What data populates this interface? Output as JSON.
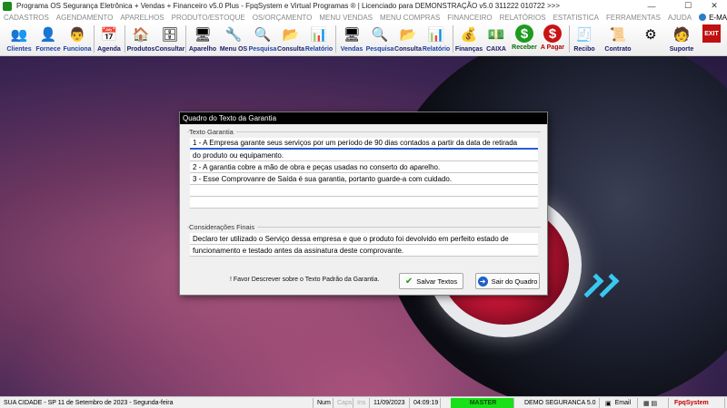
{
  "window": {
    "title": "Programa OS Segurança Eletrônica + Vendas + Financeiro v5.0 Plus - FpqSystem e Virtual Programas ® | Licenciado para  DEMONSTRAÇÃO v5.0 311222 010722 >>>",
    "minimize": "—",
    "maximize": "☐",
    "close": "✕"
  },
  "menu": {
    "items": [
      "CADASTROS",
      "AGENDAMENTO",
      "APARELHOS",
      "PRODUTO/ESTOQUE",
      "OS/ORÇAMENTO",
      "MENU VENDAS",
      "MENU COMPRAS",
      "FINANCEIRO",
      "RELATÓRIOS",
      "ESTATISTICA",
      "FERRAMENTAS",
      "AJUDA"
    ],
    "email": "E-MAIL"
  },
  "toolbar": {
    "clientes": "Clientes",
    "fornece": "Fornece",
    "funciona": "Funciona",
    "agenda": "Agenda",
    "produtos": "Produtos",
    "consultar": "Consultar",
    "aparelho": "Aparelho",
    "menu_os": "Menu OS",
    "pesquisa_os": "Pesquisa",
    "consulta_os": "Consulta",
    "relatorio_os": "Relatório",
    "vendas": "Vendas",
    "pesquisa_v": "Pesquisa",
    "consulta_v": "Consulta",
    "relatorio_v": "Relatório",
    "financas": "Finanças",
    "caixa": "CAIXA",
    "receber": "Receber",
    "pagar": "A Pagar",
    "recibo": "Recibo",
    "contrato": "Contrato",
    "suporte": "Suporte",
    "exit": "EXIT"
  },
  "dialog": {
    "title": "Quadro do Texto da Garantia",
    "garantia_label": "Texto Garantia",
    "garantia_lines": [
      "1 - A Empresa garante seus serviços por um período de 90 dias contados a partir da data de retirada",
      "do produto ou equipamento.",
      "2 - A garantia cobre a mão de obra e peças usadas no conserto do aparelho.",
      "3 - Esse Comprovanre de Saída é sua garantia, portanto guarde-a com cuidado.",
      "",
      ""
    ],
    "consideracoes_label": "Considerações Finais",
    "consideracoes_lines": [
      "Declaro ter utilizado o Serviço dessa empresa e que o produto foi devolvido em perfeito estado de",
      "funcionamento e testado antes da assinatura deste comprovante."
    ],
    "hint": "! Favor Descrever sobre o Texto Padrão da Garantia.",
    "save_label": "Salvar Textos",
    "exit_label": "Sair do Quadro"
  },
  "statusbar": {
    "city": "SUA CIDADE - SP 11 de Setembro de 2023 - Segunda-feira",
    "num": "Num",
    "caps": "Caps",
    "ins": "Ins",
    "date": "11/09/2023",
    "time": "04:09:19",
    "master": "MASTER",
    "company": "DEMO SEGURANCA 5.0",
    "email": "Email",
    "brand": "FpqSystem"
  }
}
